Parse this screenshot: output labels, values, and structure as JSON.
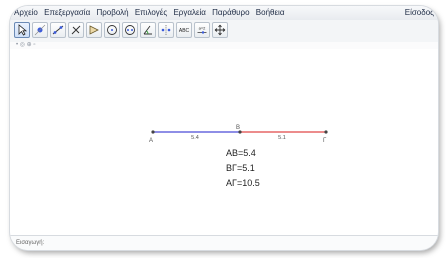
{
  "menu": {
    "items": [
      "Αρχείο",
      "Επεξεργασία",
      "Προβολή",
      "Επιλογές",
      "Εργαλεία",
      "Παράθυρο",
      "Βοήθεια"
    ],
    "login": "Είσοδος"
  },
  "toolbar": {
    "tools": [
      {
        "name": "move-tool",
        "icon": "arrow-cursor-icon",
        "active": true
      },
      {
        "name": "point-tool",
        "icon": "point-icon"
      },
      {
        "name": "line-tool",
        "icon": "line-icon"
      },
      {
        "name": "perpendicular-tool",
        "icon": "perpendicular-icon"
      },
      {
        "name": "polygon-tool",
        "icon": "polygon-icon"
      },
      {
        "name": "circle-tool",
        "icon": "circle-icon"
      },
      {
        "name": "ellipse-tool",
        "icon": "ellipse-icon"
      },
      {
        "name": "angle-tool",
        "icon": "angle-icon"
      },
      {
        "name": "reflect-tool",
        "icon": "reflect-icon"
      },
      {
        "name": "text-tool",
        "icon": "abc-icon",
        "text": "ABC"
      },
      {
        "name": "slider-tool",
        "icon": "slider-icon",
        "text": "a=2"
      },
      {
        "name": "move-view-tool",
        "icon": "move-view-icon"
      }
    ]
  },
  "subbar": {
    "text": "•  ◎  ⊕  ▫"
  },
  "geometry": {
    "points": {
      "A": "A",
      "B": "B",
      "G": "Γ"
    },
    "segment_labels": {
      "AB": "5.4",
      "BG": "5.1"
    },
    "colors": {
      "ab": "#4a4ad8",
      "bg": "#e04848"
    }
  },
  "calculations": {
    "ab": "ΑΒ=5.4",
    "bg": "ΒΓ=5.1",
    "ag": "ΑΓ=10.5"
  },
  "input_bar": {
    "label": "Εισαγωγή:"
  }
}
